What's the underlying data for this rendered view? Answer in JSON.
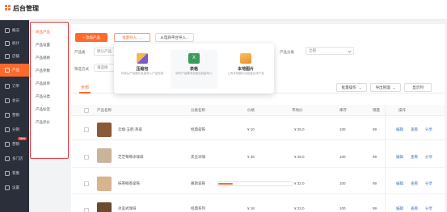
{
  "app": {
    "title": "后台管理"
  },
  "sidebar": {
    "items": [
      {
        "label": "概况",
        "icon": "home-icon"
      },
      {
        "label": "统计",
        "icon": "chart-icon"
      },
      {
        "label": "店铺",
        "icon": "shop-icon"
      },
      {
        "label": "产品",
        "icon": "box-icon",
        "active": true
      },
      {
        "label": "订单",
        "icon": "list-icon"
      },
      {
        "label": "会员",
        "icon": "user-icon"
      },
      {
        "label": "营销",
        "icon": "megaphone-icon"
      },
      {
        "label": "分销",
        "icon": "share-icon"
      },
      {
        "label": "营销",
        "icon": "gift-icon",
        "badge": "New"
      },
      {
        "label": "多门店",
        "icon": "store-icon"
      },
      {
        "label": "客服",
        "icon": "chat-icon"
      },
      {
        "label": "设置",
        "icon": "gear-icon"
      }
    ]
  },
  "submenu": {
    "items": [
      {
        "label": "商品产品",
        "active": true
      },
      {
        "label": "产品设置"
      },
      {
        "label": "产品规格"
      },
      {
        "label": "产品参数"
      },
      {
        "label": "产品屏单"
      },
      {
        "label": "产品分类"
      },
      {
        "label": "产品标签"
      },
      {
        "label": "产品评价"
      }
    ]
  },
  "toolbar": {
    "add_label": "+ 添加产品",
    "batch_import_label": "批量导入",
    "platform_import_label": "从电商平台导入..."
  },
  "filters": {
    "type_label": "产品类",
    "type_value": "默认产品",
    "category_label": "产品分类",
    "category_value": "全部",
    "search_label": "筛选方式",
    "search_value": "请选择"
  },
  "popover": {
    "items": [
      {
        "title": "压缩包",
        "desc": "可将从产品图片批量导入产品信息",
        "color": "#e9a23b"
      },
      {
        "title": "表格",
        "desc": "填写产品基本信息后批量导入",
        "color": "#3a9b5c"
      },
      {
        "title": "本地图片",
        "desc": "上传本地图片后批量生成产品",
        "color": "#f0a93b"
      }
    ]
  },
  "tabs": {
    "all": "全部"
  },
  "actions": {
    "batch_ops": "批量操作",
    "export": "导出管理",
    "columns": "显示列"
  },
  "table": {
    "headers": [
      "产品名称",
      "分类名称",
      "价格",
      "市场价",
      "库存",
      "销量",
      "操作"
    ],
    "rows": [
      {
        "name": "云端·五鹤·蒸拿",
        "category": "经典拿铁",
        "price": "¥ 10",
        "market": "¥ 25.0",
        "stock": "100",
        "sales": "99",
        "thumb": "#8a5a36"
      },
      {
        "name": "芝芝莓莓冰咖啡",
        "category": "黑豆冰咖",
        "price": "¥ 35",
        "market": "¥ 45.0",
        "stock": "100",
        "sales": "99",
        "thumb": "#c9b49a"
      },
      {
        "name": "抹茶椰香拿铁",
        "category": "慕斯拿铁",
        "price": "¥ 5",
        "market": "¥ 32.0",
        "stock": "100",
        "sales": "99",
        "thumb": "#d8b48c"
      },
      {
        "name": "冰美式咖啡",
        "category": "经典系列",
        "price": "¥ 18",
        "market": "¥ 22.0",
        "stock": "100",
        "sales": "99",
        "thumb": "#6b4a2e"
      }
    ],
    "ops": [
      "编辑",
      "查看",
      "分享"
    ]
  },
  "progress": {
    "value": 0.2
  }
}
